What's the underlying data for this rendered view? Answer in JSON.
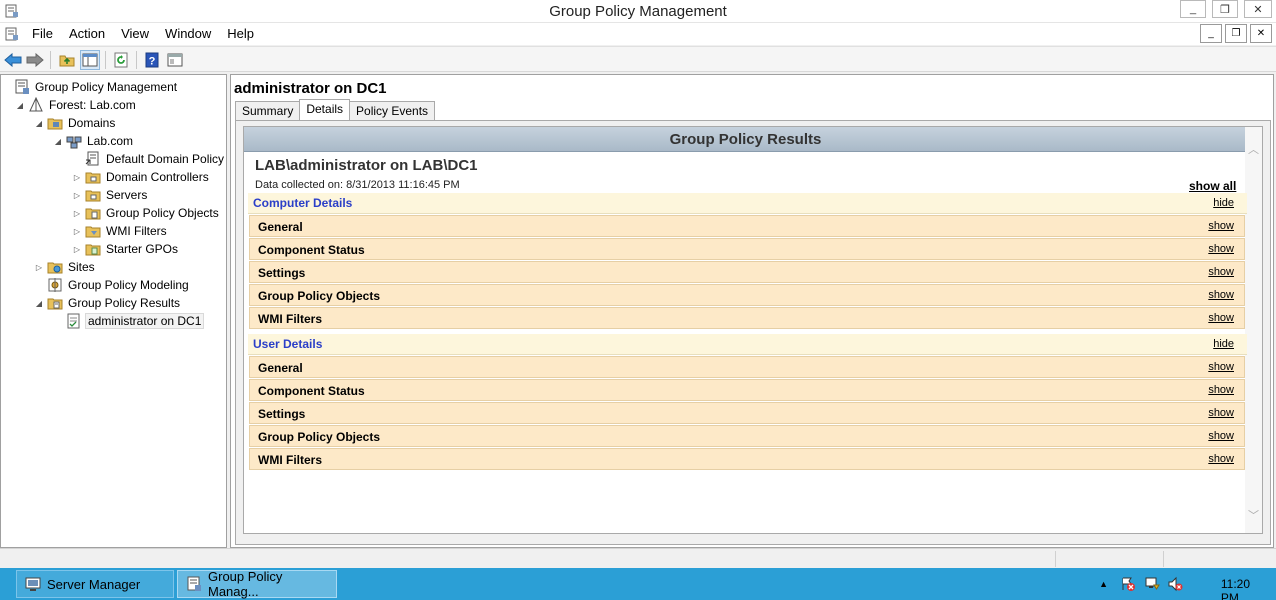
{
  "window": {
    "title": "Group Policy Management",
    "minimize": "_",
    "restore": "❐",
    "close": "✕"
  },
  "menu": {
    "items": [
      "File",
      "Action",
      "View",
      "Window",
      "Help"
    ],
    "mdi_minimize": "_",
    "mdi_restore": "❐",
    "mdi_close": "✕"
  },
  "toolbar": {
    "icons": [
      "back-arrow-icon",
      "forward-arrow-icon",
      "up-folder-icon",
      "show-hide-tree-icon",
      "refresh-icon",
      "help-icon",
      "properties-icon"
    ]
  },
  "tree": {
    "nodes": [
      {
        "label": "Group Policy Management",
        "icon": "gpm-icon",
        "expander": ""
      },
      {
        "label": "Forest: Lab.com",
        "icon": "forest-icon",
        "expander": "◢"
      },
      {
        "label": "Domains",
        "icon": "domains-folder-icon",
        "expander": "◢"
      },
      {
        "label": "Lab.com",
        "icon": "domain-icon",
        "expander": "◢"
      },
      {
        "label": "Default Domain Policy",
        "icon": "gpo-link-icon",
        "expander": ""
      },
      {
        "label": "Domain Controllers",
        "icon": "ou-folder-icon",
        "expander": "▷"
      },
      {
        "label": "Servers",
        "icon": "ou-folder-icon",
        "expander": "▷"
      },
      {
        "label": "Group Policy Objects",
        "icon": "gpo-folder-icon",
        "expander": "▷"
      },
      {
        "label": "WMI Filters",
        "icon": "wmi-folder-icon",
        "expander": "▷"
      },
      {
        "label": "Starter GPOs",
        "icon": "starter-folder-icon",
        "expander": "▷"
      },
      {
        "label": "Sites",
        "icon": "sites-folder-icon",
        "expander": "▷"
      },
      {
        "label": "Group Policy Modeling",
        "icon": "modeling-icon",
        "expander": ""
      },
      {
        "label": "Group Policy Results",
        "icon": "results-folder-icon",
        "expander": "◢"
      },
      {
        "label": "administrator on DC1",
        "icon": "result-report-icon",
        "expander": ""
      }
    ]
  },
  "main": {
    "heading": "administrator on DC1",
    "tabs": [
      "Summary",
      "Details",
      "Policy Events"
    ],
    "active_tab": "Details",
    "report": {
      "title": "Group Policy Results",
      "target": "LAB\\administrator on LAB\\DC1",
      "collected": "Data collected on: 8/31/2013 11:16:45 PM",
      "show_all": "show all",
      "computer": {
        "title": "Computer Details",
        "toggle": "hide",
        "rows": [
          {
            "name": "General",
            "link": "show"
          },
          {
            "name": "Component Status",
            "link": "show"
          },
          {
            "name": "Settings",
            "link": "show"
          },
          {
            "name": "Group Policy Objects",
            "link": "show"
          },
          {
            "name": "WMI Filters",
            "link": "show"
          }
        ]
      },
      "user": {
        "title": "User Details",
        "toggle": "hide",
        "rows": [
          {
            "name": "General",
            "link": "show"
          },
          {
            "name": "Component Status",
            "link": "show"
          },
          {
            "name": "Settings",
            "link": "show"
          },
          {
            "name": "Group Policy Objects",
            "link": "show"
          },
          {
            "name": "WMI Filters",
            "link": "show"
          }
        ]
      }
    }
  },
  "taskbar": {
    "tasks": [
      {
        "label": "Server Manager",
        "icon": "server-manager-icon"
      },
      {
        "label": "Group Policy Manag...",
        "icon": "gpm-icon"
      }
    ],
    "tray_expand": "▲",
    "clock": "11:20 PM"
  },
  "colors": {
    "section_title": "#2b3fc8",
    "row_bg": "#fde9c8",
    "section_bg": "#fdf6dc",
    "taskbar": "#2b9fd6"
  }
}
